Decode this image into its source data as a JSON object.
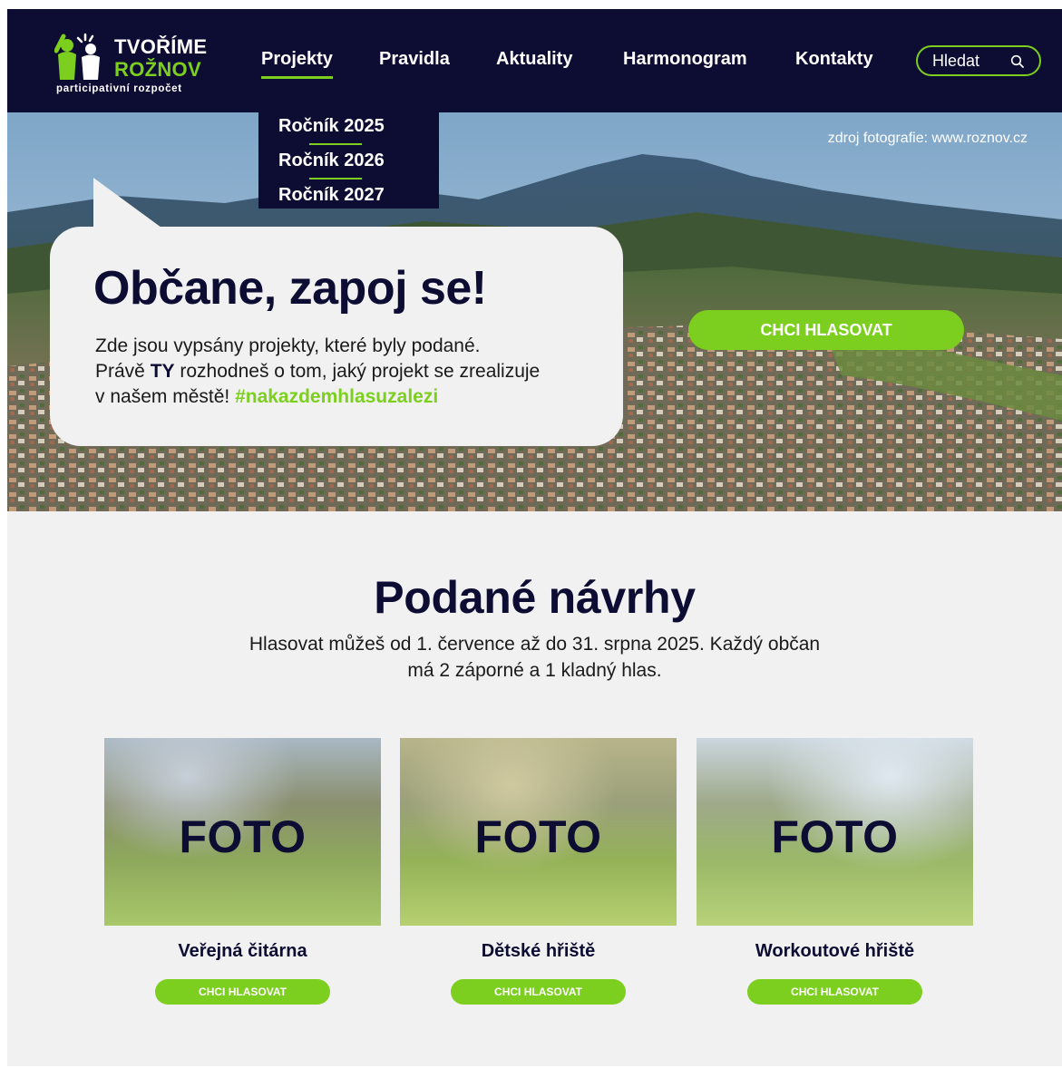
{
  "header": {
    "logo": {
      "line1": "TVOŘÍME",
      "line2": "ROŽNOV",
      "subtitle": "participativní rozpočet"
    },
    "nav": [
      {
        "label": "Projekty",
        "active": true
      },
      {
        "label": "Pravidla"
      },
      {
        "label": "Aktuality"
      },
      {
        "label": "Harmonogram"
      },
      {
        "label": "Kontakty"
      }
    ],
    "search": {
      "placeholder": "Hledat",
      "icon": "search-icon"
    }
  },
  "dropdown": {
    "items": [
      "Ročník 2025",
      "Ročník 2026",
      "Ročník 2027"
    ]
  },
  "hero": {
    "photo_credit": "zdroj fotografie: www.roznov.cz",
    "title": "Občane, zapoj se!",
    "text_line1": "Zde jsou vypsány projekty, které byly podané.",
    "text_line2_prefix": "Právě ",
    "text_line2_em": "TY",
    "text_line2_suffix": " rozhodneš o tom, jaký projekt se zrealizuje",
    "text_line3_prefix": "v našem městě! ",
    "hashtag": "#nakazdemhlasuzalezi",
    "vote_button": "CHCI HLASOVAT"
  },
  "proposals": {
    "title": "Podané návrhy",
    "text_line1": "Hlasovat můžeš od 1. července až do 31. srpna 2025. Každý občan",
    "text_line2": "má 2 záporné a 1 kladný hlas.",
    "cards": [
      {
        "photo_label": "FOTO",
        "title": "Veřejná čitárna",
        "button": "CHCI HLASOVAT"
      },
      {
        "photo_label": "FOTO",
        "title": "Dětské hřiště",
        "button": "CHCI HLASOVAT"
      },
      {
        "photo_label": "FOTO",
        "title": "Workoutové hřiště",
        "button": "CHCI HLASOVAT"
      }
    ]
  },
  "colors": {
    "navy": "#0d0c33",
    "green": "#7ccf1e",
    "background": "#f1f1f1"
  }
}
